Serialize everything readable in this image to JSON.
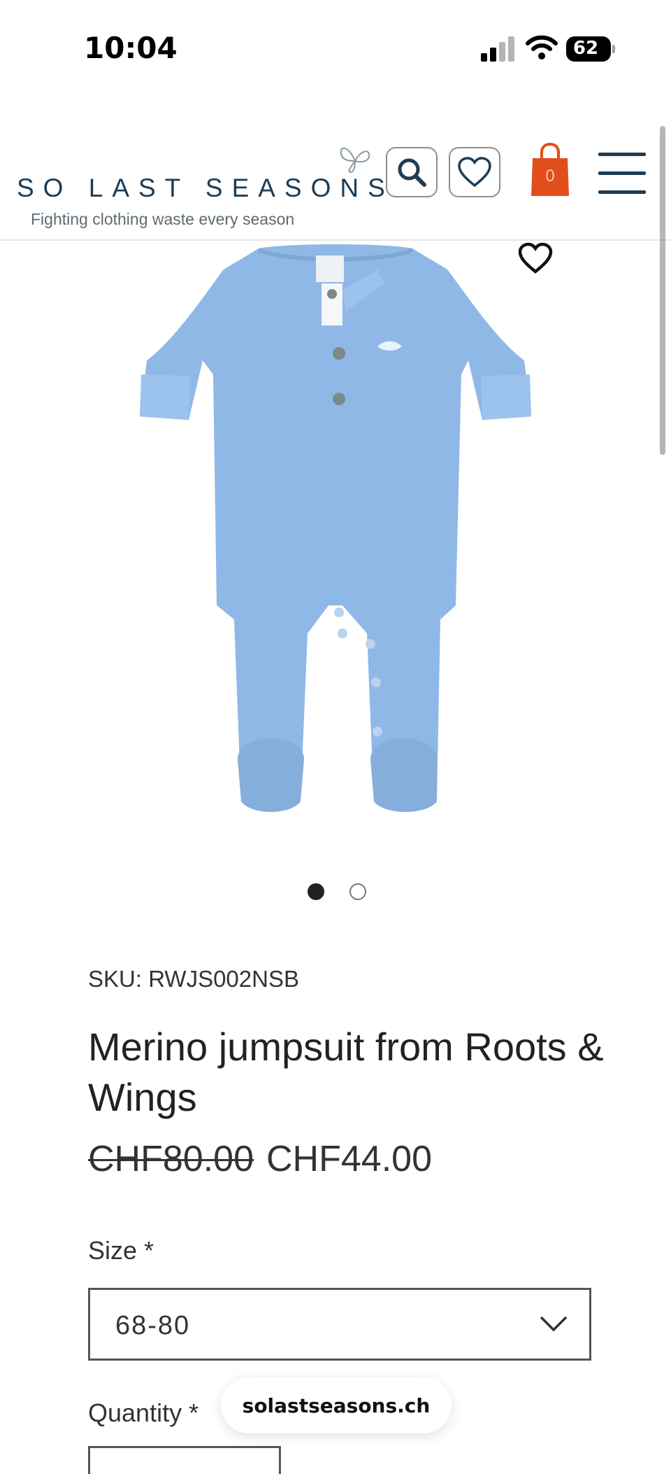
{
  "status_bar": {
    "time": "10:04",
    "battery": "62"
  },
  "header": {
    "logo_name": "SO LAST SEASONS",
    "logo_tagline": "Fighting clothing waste every season",
    "cart_count": "0",
    "icons": [
      "search-icon",
      "heart-icon",
      "shopping-bag-icon",
      "hamburger-menu-icon"
    ]
  },
  "product": {
    "sku": "SKU: RWJS002NSB",
    "title": "Merino jumpsuit from Roots & Wings",
    "price_original": "CHF80.00",
    "price_sale": "CHF44.00",
    "image_count": 2,
    "active_image": 1,
    "size": {
      "label": "Size *",
      "selected": "68-80"
    },
    "quantity": {
      "label": "Quantity *"
    }
  },
  "browser": {
    "url": "solastseasons.ch"
  },
  "colors": {
    "brand_navy": "#1e3d55",
    "cart_orange": "#e24e1b",
    "garment_blue": "#8fb8e6"
  }
}
